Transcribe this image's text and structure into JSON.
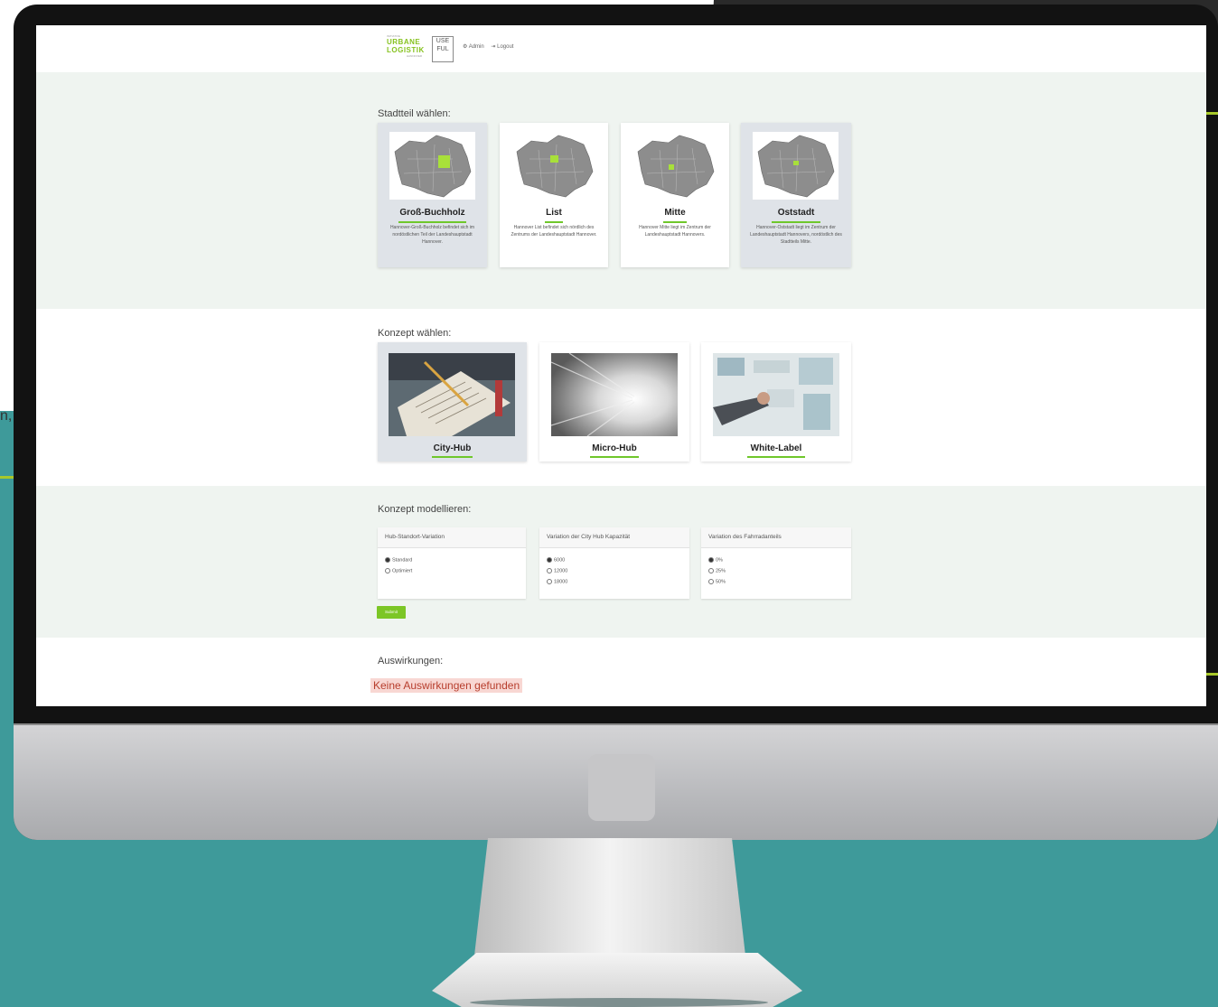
{
  "background": {
    "teal": "#3e9a9a",
    "accent_line": "#a8c82a",
    "cut_text": "n,"
  },
  "header": {
    "logo": {
      "line1": "INITIATIVE",
      "line2": "URBANE",
      "line3": "LOGISTIK",
      "line4": "HANNOVER",
      "useful": "USE FUL"
    },
    "nav": {
      "admin": "⚙ Admin",
      "logout": "⇥ Logout"
    }
  },
  "stadtteil": {
    "title": "Stadtteil wählen:",
    "cards": [
      {
        "title": "Groß-Buchholz",
        "desc": "Hannover-Groß-Buchholz befindet sich im nordöstlichen Teil der Landeshauptstadt Hannover.",
        "selected": true
      },
      {
        "title": "List",
        "desc": "Hannover List befindet sich nördlich des Zentrums der Landeshauptstadt Hannover.",
        "selected": false
      },
      {
        "title": "Mitte",
        "desc": "Hannover Mitte liegt im Zentrum der Landeshauptstadt Hannovers.",
        "selected": false
      },
      {
        "title": "Oststadt",
        "desc": "Hannover-Oststadt liegt im Zentrum der Landeshauptstadt Hannovers, nordöstlich des Stadtteils Mitte.",
        "selected": true
      }
    ]
  },
  "konzept": {
    "title": "Konzept wählen:",
    "cards": [
      {
        "title": "City-Hub",
        "selected": true
      },
      {
        "title": "Micro-Hub",
        "selected": false
      },
      {
        "title": "White-Label",
        "selected": false
      }
    ]
  },
  "modellieren": {
    "title": "Konzept modellieren:",
    "panels": [
      {
        "head": "Hub-Standort-Variation",
        "options": [
          "Standard",
          "Optimiert"
        ],
        "checked": 0
      },
      {
        "head": "Variation der City Hub Kapazität",
        "options": [
          "6000",
          "12000",
          "18000"
        ],
        "checked": 0
      },
      {
        "head": "Variation des Fahrradanteils",
        "options": [
          "0%",
          "25%",
          "50%"
        ],
        "checked": 0
      }
    ],
    "submit": "Submit"
  },
  "auswirkungen": {
    "title": "Auswirkungen:",
    "alert": "Keine Auswirkungen gefunden"
  }
}
